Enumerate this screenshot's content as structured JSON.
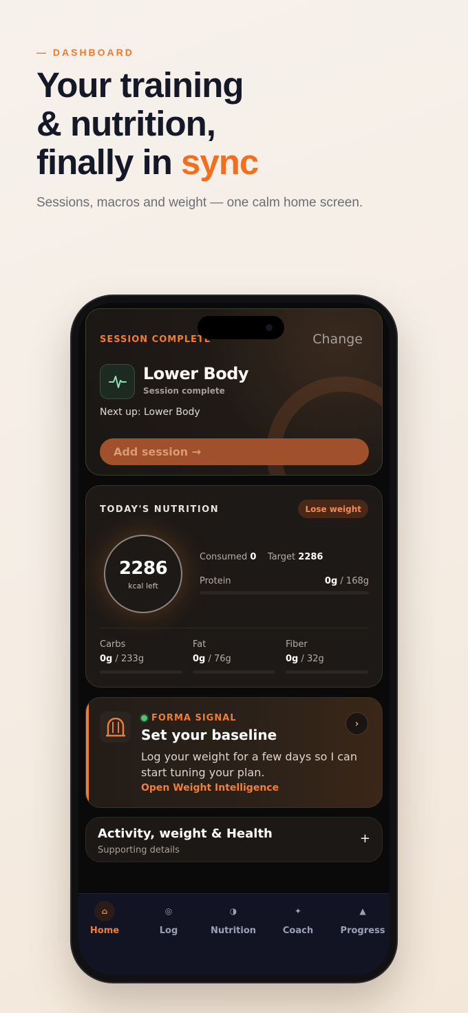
{
  "hero": {
    "eyebrow": "— DASHBOARD",
    "headline_line1": "Your training",
    "headline_line2": "& nutrition,",
    "headline_line3_prefix": "finally in ",
    "headline_line3_accent": "sync",
    "subline": "Sessions, macros and weight — one calm home screen."
  },
  "session": {
    "label": "SESSION COMPLETE",
    "change_label": "Change",
    "icon": "pulse-icon",
    "title": "Lower Body",
    "subtitle": "Session complete",
    "next_up": "Next up: Lower Body",
    "cta": "Add session →"
  },
  "nutrition": {
    "label": "TODAY'S NUTRITION",
    "goal_pill": "Lose weight",
    "kcal_left": "2286",
    "kcal_unit": "kcal left",
    "consumed_label": "Consumed",
    "consumed_value": "0",
    "target_label": "Target",
    "target_value": "2286",
    "protein": {
      "label": "Protein",
      "value": "0g",
      "target": " / 168g",
      "progress": 0
    },
    "macros": [
      {
        "label": "Carbs",
        "value": "0g",
        "target": " / 233g",
        "progress": 0
      },
      {
        "label": "Fat",
        "value": "0g",
        "target": " / 76g",
        "progress": 0
      },
      {
        "label": "Fiber",
        "value": "0g",
        "target": " / 32g",
        "progress": 0
      }
    ]
  },
  "signal": {
    "icon": "scale-icon",
    "eyebrow": "FORMA SIGNAL",
    "title": "Set your baseline",
    "body": "Log your weight for a few days so I can start tuning your plan.",
    "link": "Open Weight Intelligence",
    "chevron": "›"
  },
  "activity": {
    "title": "Activity, weight & Health",
    "subtitle": "Supporting details",
    "expand": "+"
  },
  "tabs": [
    {
      "label": "Home",
      "icon": "⌂",
      "icon_name": "home-icon",
      "active": true
    },
    {
      "label": "Log",
      "icon": "◎",
      "icon_name": "log-icon",
      "active": false
    },
    {
      "label": "Nutrition",
      "icon": "◑",
      "icon_name": "nutrition-icon",
      "active": false
    },
    {
      "label": "Coach",
      "icon": "✦",
      "icon_name": "coach-icon",
      "active": false
    },
    {
      "label": "Progress",
      "icon": "▲",
      "icon_name": "progress-icon",
      "active": false
    }
  ],
  "colors": {
    "accent": "#ef7d33",
    "signal_dot": "#52c174",
    "tabbar": "#121424"
  }
}
